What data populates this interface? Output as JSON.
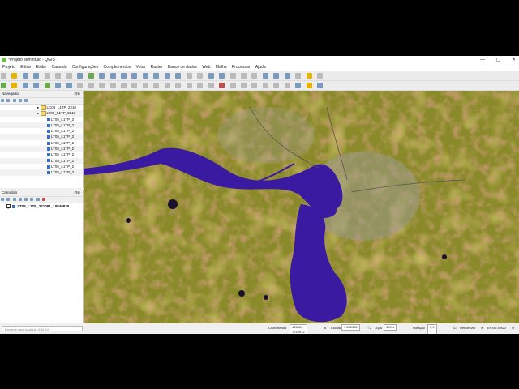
{
  "window": {
    "title": "*Projeto sem título - QGIS",
    "min": "—",
    "max": "▢",
    "close": "✕"
  },
  "menu": [
    "Projeto",
    "Editar",
    "Exibir",
    "Camada",
    "Configurações",
    "Complementos",
    "Vetor",
    "Raster",
    "Banco de dados",
    "Web",
    "Malha",
    "Processar",
    "Ajuda"
  ],
  "navigator": {
    "title": "Navegador",
    "close": "⊡⊗",
    "items": [
      {
        "label": "LC08_L1TP_2210",
        "kind": "folder",
        "indent": 1
      },
      {
        "label": "LT05_L1TP_2210",
        "kind": "folder",
        "indent": 1
      },
      {
        "label": "LT05_L1TP_2",
        "kind": "raster",
        "indent": 2
      },
      {
        "label": "LT05_L1TP_2",
        "kind": "raster",
        "indent": 2
      },
      {
        "label": "LT05_L1TP_2",
        "kind": "raster",
        "indent": 2
      },
      {
        "label": "LT05_L1TP_2",
        "kind": "raster",
        "indent": 2
      },
      {
        "label": "LT05_L1TP_2",
        "kind": "raster",
        "indent": 2
      },
      {
        "label": "LT05_L1TP_2",
        "kind": "raster",
        "indent": 2
      },
      {
        "label": "LT05_L1TP_2",
        "kind": "raster",
        "indent": 2
      },
      {
        "label": "LT05_L1TP_2",
        "kind": "raster",
        "indent": 2
      },
      {
        "label": "LT05_L1TP_2",
        "kind": "raster",
        "indent": 2
      },
      {
        "label": "LT05_L1TP_2",
        "kind": "raster",
        "indent": 2
      }
    ]
  },
  "layers": {
    "title": "Camadas",
    "close": "⊡⊗",
    "items": [
      {
        "label": "LT05_L1TP_221081_19840830",
        "checked": true
      }
    ]
  },
  "search": {
    "placeholder": "Escreva para localizar (Ctrl+K)"
  },
  "status": {
    "coord_label": "Coordenada",
    "coord_value": "415409, 7219912",
    "scale_label": "Escala",
    "scale_value": "1:242685",
    "magnifier_label": "Lupa",
    "magnifier_value": "100%",
    "rotation_label": "Rotação",
    "rotation_value": "0,0 °",
    "render_label": "Renderizar",
    "crs": "EPSG:32622"
  },
  "colors": {
    "water": "#3a1aa0",
    "vegetation": "#8a8a2a",
    "soil": "#b05a3a"
  }
}
